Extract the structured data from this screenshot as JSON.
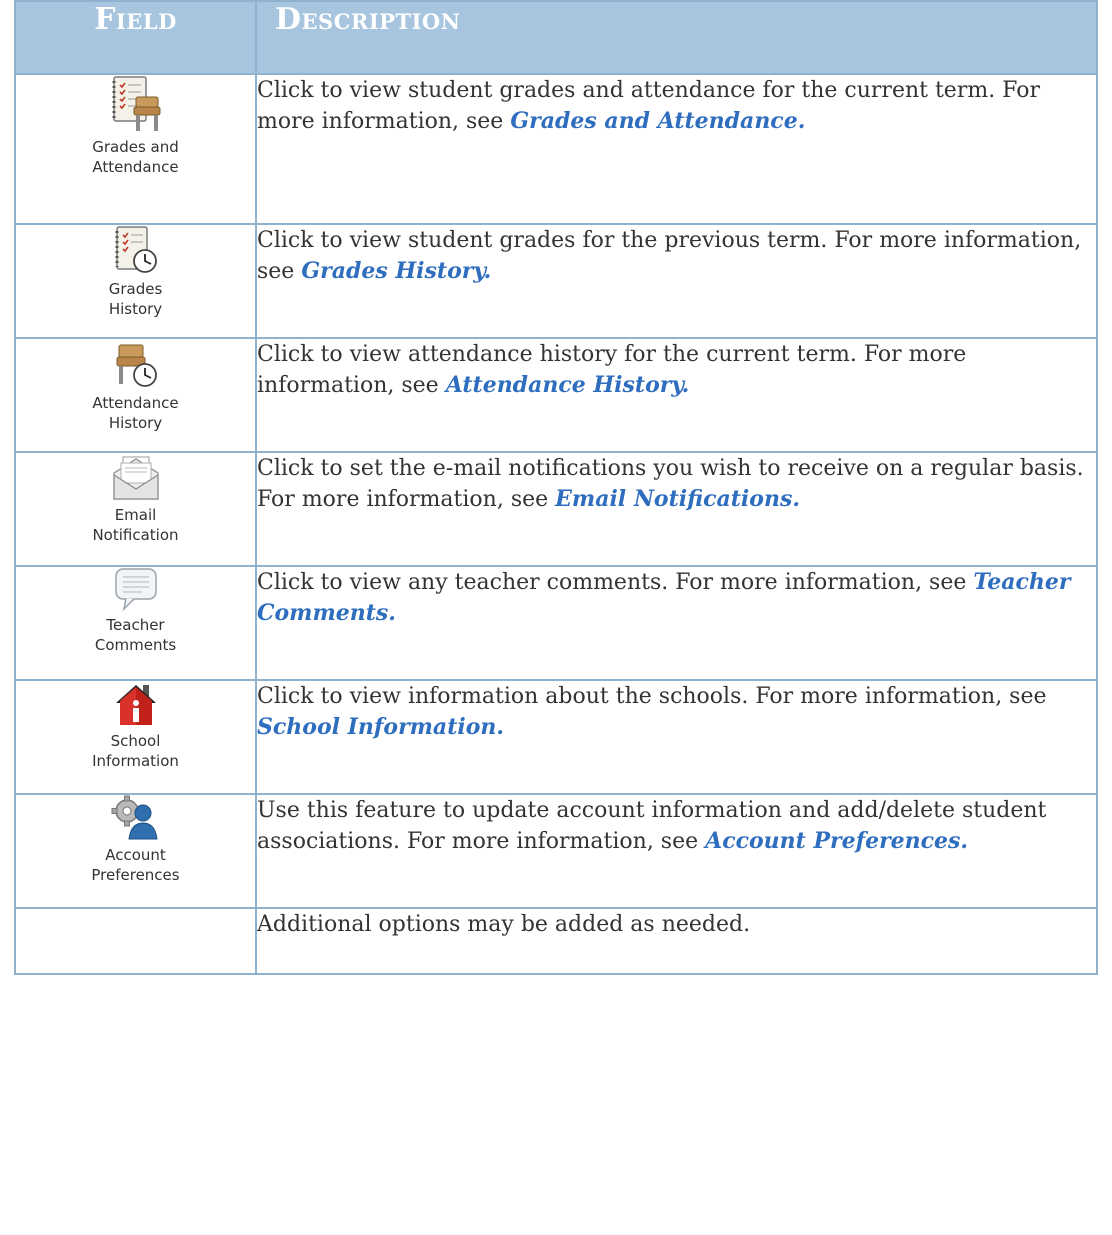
{
  "header": {
    "field": "Field",
    "description": "Description"
  },
  "rows": [
    {
      "label_line1": "Grades and",
      "label_line2": "Attendance",
      "icon": "grades-attendance-icon",
      "text": "Click to view student grades and attendance for the current term.  For more information, see ",
      "link": "Grades and Attendance."
    },
    {
      "label_line1": "Grades",
      "label_line2": "History",
      "icon": "grades-history-icon",
      "text": "Click to view student grades for the previous term.  For more information, see ",
      "link": "Grades History."
    },
    {
      "label_line1": "Attendance",
      "label_line2": "History",
      "icon": "attendance-history-icon",
      "text": "Click to view attendance history for the current term.  For more information, see ",
      "link": "Attendance History."
    },
    {
      "label_line1": "Email",
      "label_line2": "Notification",
      "icon": "email-notification-icon",
      "text": "Click to set the e-mail notifications you wish to receive on a regular basis.  For more information, see ",
      "link": "Email Notifications."
    },
    {
      "label_line1": "Teacher",
      "label_line2": "Comments",
      "icon": "teacher-comments-icon",
      "text": "Click to view any teacher comments.  For more information, see ",
      "link": "Teacher Comments."
    },
    {
      "label_line1": "School",
      "label_line2": "Information",
      "icon": "school-information-icon",
      "text": "Click to view information about the schools.  For more information, see ",
      "link": "School Information."
    },
    {
      "label_line1": "Account",
      "label_line2": "Preferences",
      "icon": "account-preferences-icon",
      "text": "Use this feature to update account information and add/delete student associations.  For more information, see ",
      "link": "Account Preferences."
    }
  ],
  "final_row": {
    "text": "Additional options may be added as needed."
  },
  "colors": {
    "header_bg": "#a7c5de",
    "border": "#8fb3cf",
    "link": "#2f6ebf",
    "body_text": "#333333"
  }
}
